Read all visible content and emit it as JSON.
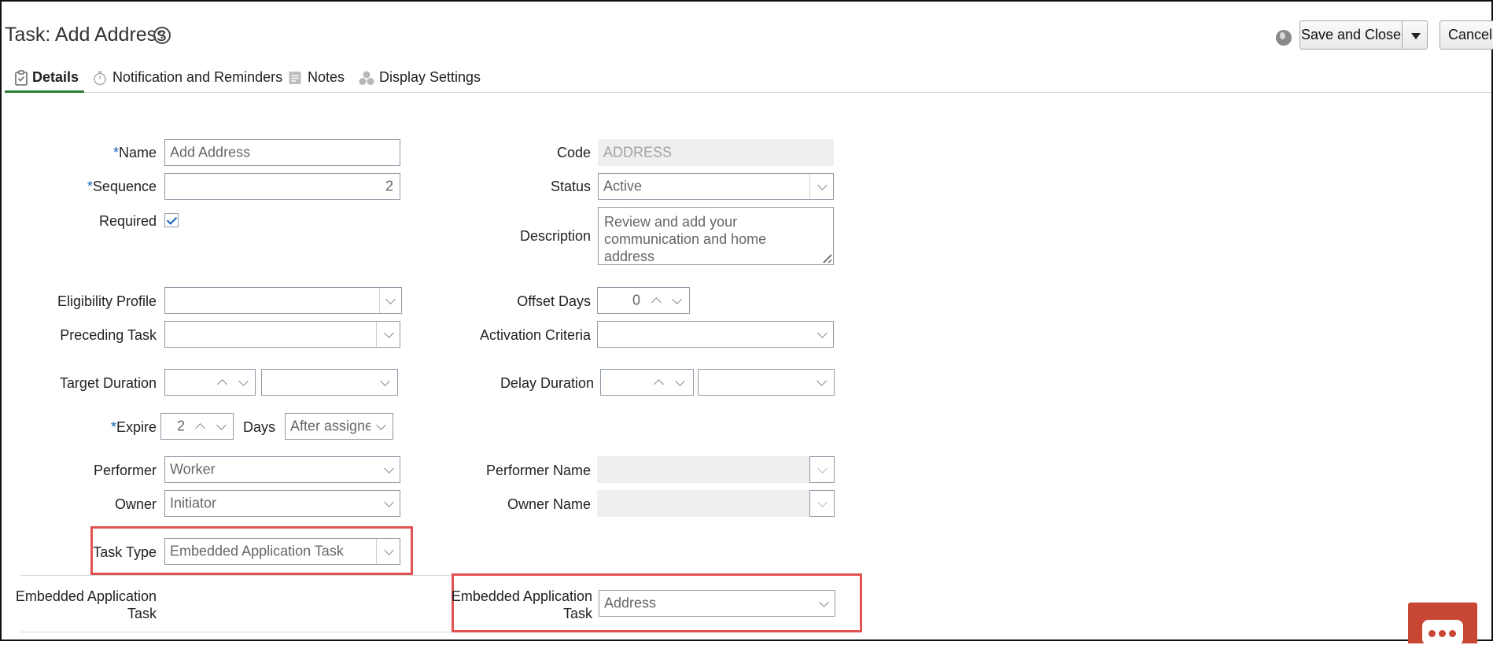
{
  "header": {
    "title": "Task: Add Address",
    "help_icon": "help-circle-icon",
    "globe_icon": "globe-icon",
    "save_label": "Save and Close",
    "cancel_label": "Cancel"
  },
  "tabs": [
    {
      "label": "Details",
      "icon": "clipboard-icon",
      "active": true
    },
    {
      "label": "Notification and Reminders",
      "icon": "stopwatch-icon",
      "active": false
    },
    {
      "label": "Notes",
      "icon": "note-icon",
      "active": false
    },
    {
      "label": "Display Settings",
      "icon": "shapes-icon",
      "active": false
    }
  ],
  "form": {
    "name": {
      "required_mark": "*",
      "label": "Name",
      "value": "Add Address"
    },
    "sequence": {
      "required_mark": "*",
      "label": "Sequence",
      "value": "2"
    },
    "required": {
      "label": "Required",
      "checked": true
    },
    "code": {
      "label": "Code",
      "value": "ADDRESS"
    },
    "status": {
      "label": "Status",
      "value": "Active"
    },
    "description": {
      "label": "Description",
      "value": "Review and add your communication and home address"
    },
    "eligibility_profile": {
      "label": "Eligibility Profile",
      "value": ""
    },
    "preceding_task": {
      "label": "Preceding Task",
      "value": ""
    },
    "offset_days": {
      "label": "Offset Days",
      "value": "0"
    },
    "activation_criteria": {
      "label": "Activation Criteria",
      "value": ""
    },
    "target_duration": {
      "label": "Target Duration",
      "value": "",
      "unit": ""
    },
    "delay_duration": {
      "label": "Delay Duration",
      "value": "",
      "unit": ""
    },
    "expire": {
      "required_mark": "*",
      "label": "Expire",
      "value": "2",
      "unit_label": "Days",
      "relative_to": "After assigned"
    },
    "performer": {
      "label": "Performer",
      "value": "Worker"
    },
    "owner": {
      "label": "Owner",
      "value": "Initiator"
    },
    "performer_name": {
      "label": "Performer Name",
      "value": ""
    },
    "owner_name": {
      "label": "Owner Name",
      "value": ""
    },
    "task_type": {
      "label": "Task Type",
      "value": "Embedded Application Task"
    },
    "embedded_section": {
      "label_line1": "Embedded Application",
      "label_line2": "Task"
    },
    "embedded_task": {
      "label_line1": "Embedded Application",
      "label_line2": "Task",
      "value": "Address"
    }
  },
  "colors": {
    "accent": "#2e7d32",
    "required": "#1466b8",
    "highlight": "#e15252",
    "chat": "#c74634"
  },
  "chat_icon": "chat-bubble-icon"
}
